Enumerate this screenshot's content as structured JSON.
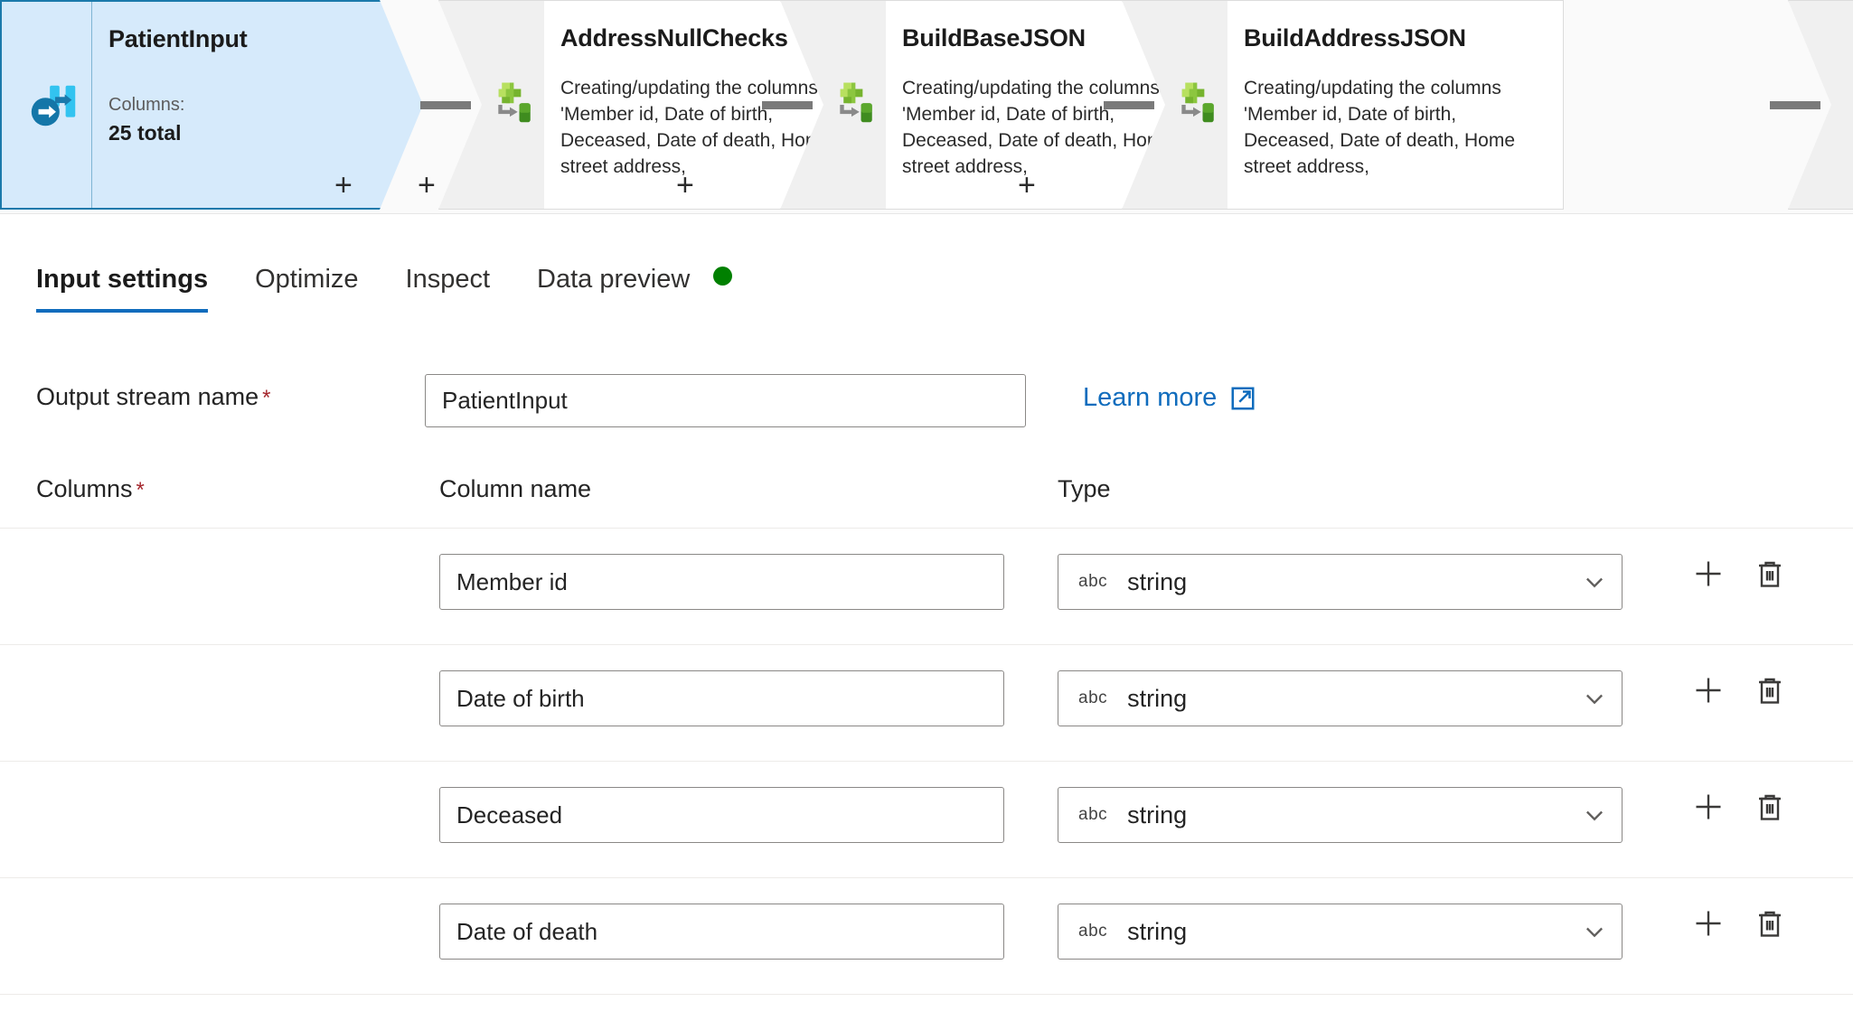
{
  "canvas": {
    "nodes": [
      {
        "name": "PatientInput",
        "kind": "source",
        "icon": "source-icon",
        "sub_label": "Columns:",
        "count": "25 total",
        "selected": true,
        "plus_label": "+"
      },
      {
        "name": "AddressNullChecks",
        "kind": "derived-column",
        "icon": "derived-column-icon",
        "description": "Creating/updating the columns 'Member id, Date of birth, Deceased, Date of death, Home street address,",
        "plus_label": "+"
      },
      {
        "name": "BuildBaseJSON",
        "kind": "derived-column",
        "icon": "derived-column-icon",
        "description": "Creating/updating the columns 'Member id, Date of birth, Deceased, Date of death, Home street address,",
        "plus_label": "+"
      },
      {
        "name": "BuildAddressJSON",
        "kind": "derived-column",
        "icon": "derived-column-icon",
        "description": "Creating/updating the columns 'Member id, Date of birth, Deceased, Date of death, Home street address,",
        "plus_label": "+"
      },
      {
        "name": "",
        "kind": "flatten",
        "icon": "flatten-icon",
        "description": "",
        "plus_label": ""
      }
    ],
    "colors": {
      "selection_rail": "#0078d4",
      "source_fill": "#d6eafb",
      "source_border": "#1b79ab",
      "connector": "#7a7a7a"
    }
  },
  "tabs": [
    {
      "label": "Input settings",
      "active": true,
      "indicator": null
    },
    {
      "label": "Optimize",
      "active": false,
      "indicator": null
    },
    {
      "label": "Inspect",
      "active": false,
      "indicator": null
    },
    {
      "label": "Data preview",
      "active": false,
      "indicator": "#008000"
    }
  ],
  "form": {
    "output_stream": {
      "label": "Output stream name",
      "required_mark": "*",
      "value": "PatientInput",
      "placeholder": "Output stream name"
    },
    "learn_more": {
      "label": "Learn more",
      "icon": "external-link-icon",
      "color": "#0f6cbd"
    },
    "columns_label": "Columns",
    "columns_required_mark": "*",
    "grid_headers": {
      "name": "Column name",
      "type": "Type"
    },
    "type_prefix": "abc",
    "rows": [
      {
        "name": "Member id",
        "type": "string",
        "type_prefix": "abc"
      },
      {
        "name": "Date of birth",
        "type": "string",
        "type_prefix": "abc"
      },
      {
        "name": "Deceased",
        "type": "string",
        "type_prefix": "abc"
      },
      {
        "name": "Date of death",
        "type": "string",
        "type_prefix": "abc"
      }
    ],
    "row_actions": {
      "add": "add-row-icon",
      "delete": "delete-row-icon"
    }
  }
}
